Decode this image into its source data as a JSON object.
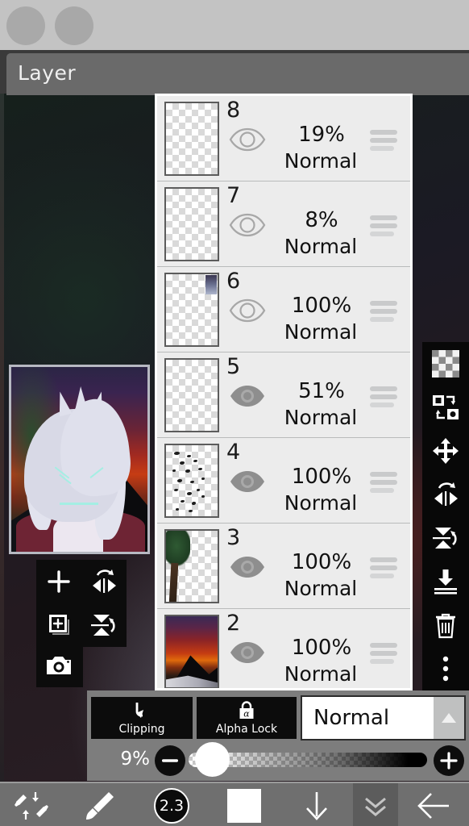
{
  "app": {
    "header_title": "Layer"
  },
  "top_tools": [
    {
      "name": "tool-circle-1",
      "icon": "circle-icon"
    },
    {
      "name": "tool-circle-2",
      "icon": "circle-icon"
    }
  ],
  "float_tools": [
    {
      "name": "add-layer-button",
      "icon": "plus-icon"
    },
    {
      "name": "flip-horizontal-button",
      "icon": "flip-horizontal-icon"
    },
    {
      "name": "duplicate-layer-button",
      "icon": "duplicate-layer-icon"
    },
    {
      "name": "flip-vertical-button",
      "icon": "flip-vertical-icon"
    },
    {
      "name": "camera-button",
      "icon": "camera-icon"
    }
  ],
  "layers": [
    {
      "number": "8",
      "opacity": "19%",
      "blend": "Normal",
      "visible": false,
      "thumb": "empty"
    },
    {
      "number": "7",
      "opacity": "8%",
      "blend": "Normal",
      "visible": false,
      "thumb": "empty"
    },
    {
      "number": "6",
      "opacity": "100%",
      "blend": "Normal",
      "visible": false,
      "thumb": "corner-mark"
    },
    {
      "number": "5",
      "opacity": "51%",
      "blend": "Normal",
      "visible": true,
      "thumb": "empty"
    },
    {
      "number": "4",
      "opacity": "100%",
      "blend": "Normal",
      "visible": true,
      "thumb": "speckles"
    },
    {
      "number": "3",
      "opacity": "100%",
      "blend": "Normal",
      "visible": true,
      "thumb": "tree"
    },
    {
      "number": "2",
      "opacity": "100%",
      "blend": "Normal",
      "visible": true,
      "thumb": "sunset"
    }
  ],
  "right_sidebar": [
    {
      "name": "transparency-button",
      "icon": "checkerboard-icon"
    },
    {
      "name": "swap-layer-button",
      "icon": "swap-layers-icon"
    },
    {
      "name": "move-layer-button",
      "icon": "move-arrows-icon"
    },
    {
      "name": "rotate-flip-h-button",
      "icon": "flip-horizontal-icon"
    },
    {
      "name": "rotate-flip-v-button",
      "icon": "flip-vertical-icon"
    },
    {
      "name": "merge-down-button",
      "icon": "merge-down-icon"
    },
    {
      "name": "delete-layer-button",
      "icon": "trash-icon"
    },
    {
      "name": "more-options-button",
      "icon": "more-vertical-icon"
    }
  ],
  "bottom_panel": {
    "clipping_label": "Clipping",
    "alpha_lock_label": "Alpha Lock",
    "blend_mode_value": "Normal",
    "opacity_value": "9%"
  },
  "bottom_bar": {
    "items": [
      {
        "name": "brush-eraser-swap-button",
        "icon": "brush-eraser-swap-icon",
        "label": ""
      },
      {
        "name": "brush-tool-button",
        "icon": "brush-icon",
        "label": ""
      },
      {
        "name": "brush-size-button",
        "icon": "size-badge-icon",
        "label": "2.3"
      },
      {
        "name": "color-swatch-button",
        "icon": "color-swatch-icon",
        "label": ""
      },
      {
        "name": "download-button",
        "icon": "arrow-down-icon",
        "label": ""
      },
      {
        "name": "collapse-panel-button",
        "icon": "double-chevron-down-icon",
        "label": ""
      },
      {
        "name": "back-button",
        "icon": "arrow-left-icon",
        "label": ""
      }
    ]
  },
  "colors": {
    "header_bg": "#6a6a6a",
    "panel_bg": "#eceded",
    "toolbar_bg": "#6f6f6f",
    "button_black": "#0c0c0c",
    "bottom_panel_bg": "#7d7d7d"
  }
}
